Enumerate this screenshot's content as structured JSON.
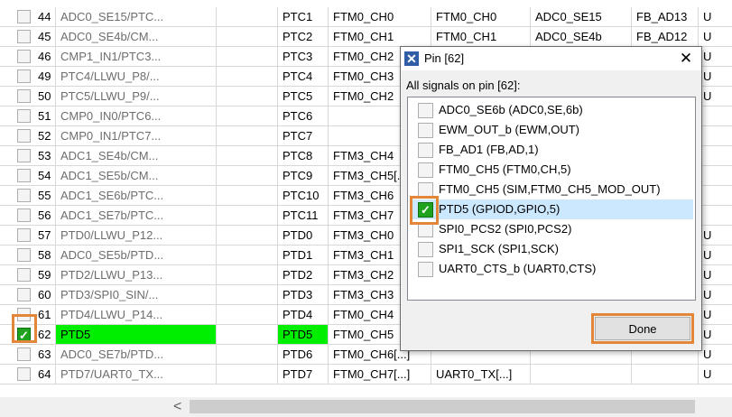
{
  "table": {
    "rows": [
      {
        "num": "44",
        "name": "ADC0_SE15/PTC...",
        "pin": "PTC1",
        "f1": "FTM0_CH0",
        "f2": "FTM0_CH0",
        "f3": "ADC0_SE15",
        "f4": "FB_AD13",
        "f5": "U",
        "checked": false
      },
      {
        "num": "45",
        "name": "ADC0_SE4b/CM...",
        "pin": "PTC2",
        "f1": "FTM0_CH1",
        "f2": "FTM0_CH1",
        "f3": "ADC0_SE4b",
        "f4": "FB_AD12",
        "f5": "U",
        "checked": false
      },
      {
        "num": "46",
        "name": "CMP1_IN1/PTC3...",
        "pin": "PTC3",
        "f1": "FTM0_CH2",
        "f2": "",
        "f3": "",
        "f4": "",
        "f5": "U",
        "checked": false
      },
      {
        "num": "49",
        "name": "PTC4/LLWU_P8/...",
        "pin": "PTC4",
        "f1": "FTM0_CH3",
        "f2": "",
        "f3": "",
        "f4": "",
        "f5": "U",
        "checked": false
      },
      {
        "num": "50",
        "name": "PTC5/LLWU_P9/...",
        "pin": "PTC5",
        "f1": "FTM0_CH2",
        "f2": "",
        "f3": "",
        "f4": "",
        "f5": "U",
        "checked": false
      },
      {
        "num": "51",
        "name": "CMP0_IN0/PTC6...",
        "pin": "PTC6",
        "f1": "",
        "f2": "",
        "f3": "",
        "f4": "",
        "f5": "",
        "checked": false
      },
      {
        "num": "52",
        "name": "CMP0_IN1/PTC7...",
        "pin": "PTC7",
        "f1": "",
        "f2": "",
        "f3": "",
        "f4": "",
        "f5": "",
        "checked": false
      },
      {
        "num": "53",
        "name": "ADC1_SE4b/CM...",
        "pin": "PTC8",
        "f1": "FTM3_CH4",
        "f2": "",
        "f3": "",
        "f4": "",
        "f5": "",
        "checked": false
      },
      {
        "num": "54",
        "name": "ADC1_SE5b/CM...",
        "pin": "PTC9",
        "f1": "FTM3_CH5[...]",
        "f2": "",
        "f3": "",
        "f4": "",
        "f5": "",
        "checked": false
      },
      {
        "num": "55",
        "name": "ADC1_SE6b/PTC...",
        "pin": "PTC10",
        "f1": "FTM3_CH6",
        "f2": "",
        "f3": "",
        "f4": "",
        "f5": "",
        "checked": false
      },
      {
        "num": "56",
        "name": "ADC1_SE7b/PTC...",
        "pin": "PTC11",
        "f1": "FTM3_CH7",
        "f2": "",
        "f3": "",
        "f4": "",
        "f5": "",
        "checked": false
      },
      {
        "num": "57",
        "name": "PTD0/LLWU_P12...",
        "pin": "PTD0",
        "f1": "FTM3_CH0",
        "f2": "",
        "f3": "",
        "f4": "",
        "f5": "U",
        "checked": false
      },
      {
        "num": "58",
        "name": "ADC0_SE5b/PTD...",
        "pin": "PTD1",
        "f1": "FTM3_CH1",
        "f2": "",
        "f3": "",
        "f4": "",
        "f5": "U",
        "checked": false
      },
      {
        "num": "59",
        "name": "PTD2/LLWU_P13...",
        "pin": "PTD2",
        "f1": "FTM3_CH2",
        "f2": "",
        "f3": "",
        "f4": "",
        "f5": "U",
        "checked": false
      },
      {
        "num": "60",
        "name": "PTD3/SPI0_SIN/...",
        "pin": "PTD3",
        "f1": "FTM3_CH3",
        "f2": "",
        "f3": "",
        "f4": "",
        "f5": "U",
        "checked": false
      },
      {
        "num": "61",
        "name": "PTD4/LLWU_P14...",
        "pin": "PTD4",
        "f1": "FTM0_CH4",
        "f2": "",
        "f3": "",
        "f4": "",
        "f5": "U",
        "checked": false
      },
      {
        "num": "62",
        "name": "PTD5",
        "pin": "PTD5",
        "f1": "FTM0_CH5",
        "f2": "",
        "f3": "",
        "f4": "",
        "f5": "U",
        "checked": true
      },
      {
        "num": "63",
        "name": "ADC0_SE7b/PTD...",
        "pin": "PTD6",
        "f1": "FTM0_CH6[...]",
        "f2": "",
        "f3": "",
        "f4": "",
        "f5": "U",
        "checked": false
      },
      {
        "num": "64",
        "name": "PTD7/UART0_TX...",
        "pin": "PTD7",
        "f1": "FTM0_CH7[...]",
        "f2": "UART0_TX[...]",
        "f3": "",
        "f4": "",
        "f5": "U",
        "checked": false
      }
    ]
  },
  "dialog": {
    "title": "Pin [62]",
    "close_label": "✕",
    "signals_label": "All signals on pin [62]:",
    "signals": [
      {
        "label": "ADC0_SE6b (ADC0,SE,6b)",
        "checked": false
      },
      {
        "label": "EWM_OUT_b (EWM,OUT)",
        "checked": false
      },
      {
        "label": "FB_AD1 (FB,AD,1)",
        "checked": false
      },
      {
        "label": "FTM0_CH5 (FTM0,CH,5)",
        "checked": false
      },
      {
        "label": "FTM0_CH5 (SIM,FTM0_CH5_MOD_OUT)",
        "checked": false
      },
      {
        "label": "PTD5 (GPIOD,GPIO,5)",
        "checked": true
      },
      {
        "label": "SPI0_PCS2 (SPI0,PCS2)",
        "checked": false
      },
      {
        "label": "SPI1_SCK (SPI1,SCK)",
        "checked": false
      },
      {
        "label": "UART0_CTS_b (UART0,CTS)",
        "checked": false
      }
    ],
    "done_label": "Done"
  },
  "scrollbar": {
    "left_arrow": "<"
  },
  "colors": {
    "enabled_highlight": "#00ee00",
    "callout": "#e2873a",
    "selection": "#cce8ff"
  }
}
